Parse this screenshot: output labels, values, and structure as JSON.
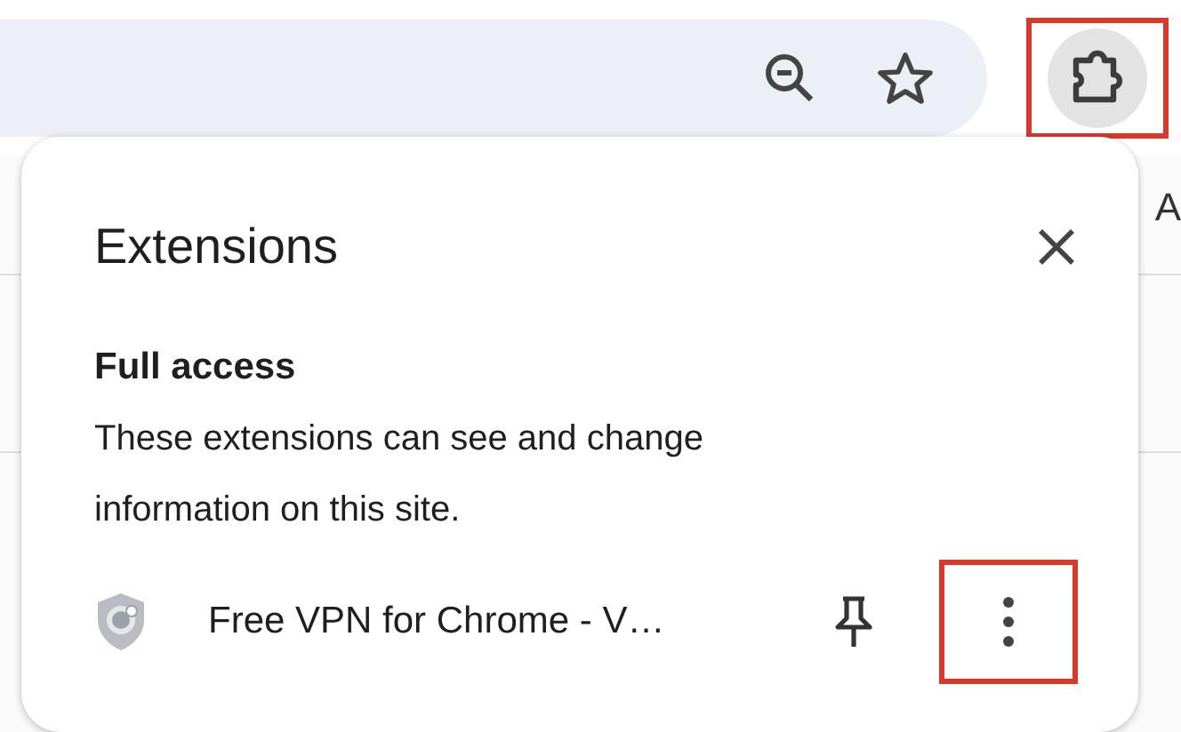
{
  "toolbar": {
    "extensions_button": {
      "highlighted": true
    }
  },
  "background_text": "A",
  "popup": {
    "title": "Extensions",
    "section": {
      "heading": "Full access",
      "description": "These extensions can see and change information on this site."
    },
    "extensions": [
      {
        "name": "Free VPN for Chrome - V…",
        "pinned": false,
        "menu_highlighted": true
      }
    ]
  }
}
